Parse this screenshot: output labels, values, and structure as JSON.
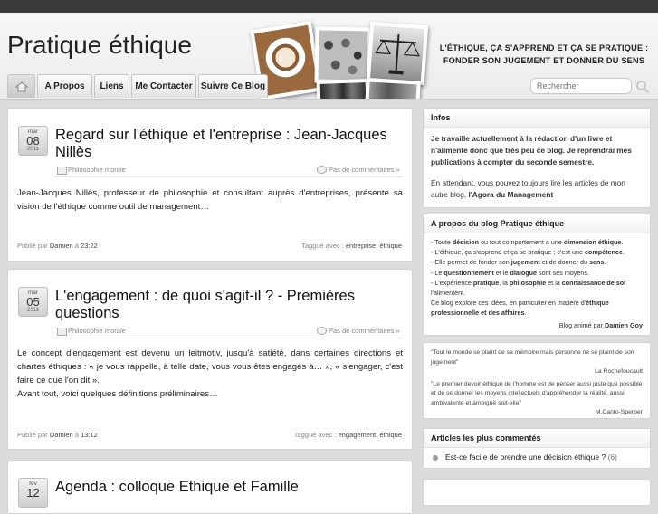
{
  "site": {
    "title": "Pratique éthique",
    "tagline_line1": "L'ÉTHIQUE, ÇA S'APPREND ET ÇA SE PRATIQUE :",
    "tagline_line2": "FONDER SON JUGEMENT ET DONNER DU SENS"
  },
  "nav": {
    "home_icon": "home-icon",
    "items": [
      "A Propos",
      "Liens",
      "Me Contacter",
      "Suivre Ce Blog"
    ]
  },
  "search": {
    "placeholder": "Rechercher"
  },
  "posts": [
    {
      "month": "mar",
      "day": "08",
      "year": "2011",
      "title": "Regard sur l'éthique et l'entreprise : Jean-Jacques Nillès",
      "category": "Philosophie morale",
      "comments": "Pas de commentaires »",
      "excerpt": "Jean-Jacques Nillès, professeur de philosophie et consultant auprès d'entreprises, présente sa vision de l'éthique comme outil de management…",
      "published_prefix": "Publié par",
      "author": "Damien",
      "time_prefix": "à",
      "time": "23:22",
      "tags_prefix": "Taggué avec :",
      "tags": "entreprise, éthique"
    },
    {
      "month": "mar",
      "day": "05",
      "year": "2011",
      "title": "L'engagement : de quoi s'agit-il ? - Premières questions",
      "category": "Philosophie morale",
      "comments": "Pas de commentaires »",
      "excerpt_line1": "Le concept d'engagement est devenu un leitmotiv, jusqu'à satiété, dans certaines directions et chartes éthiques : « je vous rappelle, à telle date, vous vous êtes engagés à… », « s'engager, c'est faire ce que l'on dit ».",
      "excerpt_line2": "Avant tout, voici quelques définitions préliminaires…",
      "published_prefix": "Publié par",
      "author": "Damien",
      "time_prefix": "à",
      "time": "13:12",
      "tags_prefix": "Taggué avec :",
      "tags": "engagement, éthique"
    },
    {
      "month": "fév",
      "day": "12",
      "title": "Agenda : colloque Ethique et Famille"
    }
  ],
  "sidebar": {
    "infos": {
      "title": "Infos",
      "bold_text": "Je travaille actuellement à la rédaction d'un livre et n'alimente donc que très peu ce blog. Je reprendrai mes publications à compter du seconde semestre.",
      "text_before": "En attendant, vous pouvez toujours lire les articles de mon autre blog,",
      "link": "l'Agora du Management"
    },
    "about": {
      "title": "A propos du blog Pratique éthique",
      "lines": [
        [
          "- Toute ",
          "décision",
          " ou tout comportement a une ",
          "dimension éthique",
          "."
        ],
        [
          "- L'éthique, ça s'apprend et ça se pratique ; c'est une ",
          "compétence",
          "."
        ],
        [
          "- Elle permet de fonder son ",
          "jugement",
          " et de donner du ",
          "sens",
          "."
        ],
        [
          "- Le ",
          "questionnement",
          " et le ",
          "dialogue",
          " sont ses moyens."
        ],
        [
          "- L'expérience ",
          "pratique",
          ", la ",
          "philosophie",
          " et la ",
          "connaissance de soi",
          ""
        ],
        [
          "l'alimentent.",
          "",
          "",
          "",
          ""
        ],
        [
          "Ce blog explore ces idées, en particulier en matière d'",
          "éthique",
          "",
          "",
          ""
        ],
        [
          "",
          "professionnelle et des affaires",
          ".",
          "",
          ""
        ]
      ],
      "signature_prefix": "Blog animé par",
      "signature_name": "Damien Goy"
    },
    "quotes": [
      {
        "text": "\"Tout le monde se plaint de sa mémoire mais personne ne se plaint de son jugement\"",
        "author": "La Rochefoucault"
      },
      {
        "text": "\"Le premier devoir éthique de l'homme est de penser aussi juste que possible et de se donner les moyens intellectuels d'appréhender la réalité, aussi ambivalente et ambiguë soit-elle\"",
        "author": "M.Canto-Sperber"
      }
    ],
    "recent": {
      "title": "Articles les plus commentés",
      "items": [
        {
          "label": "Est-ce facile de prendre une décision éthique ?",
          "count": "(6)"
        }
      ]
    }
  }
}
